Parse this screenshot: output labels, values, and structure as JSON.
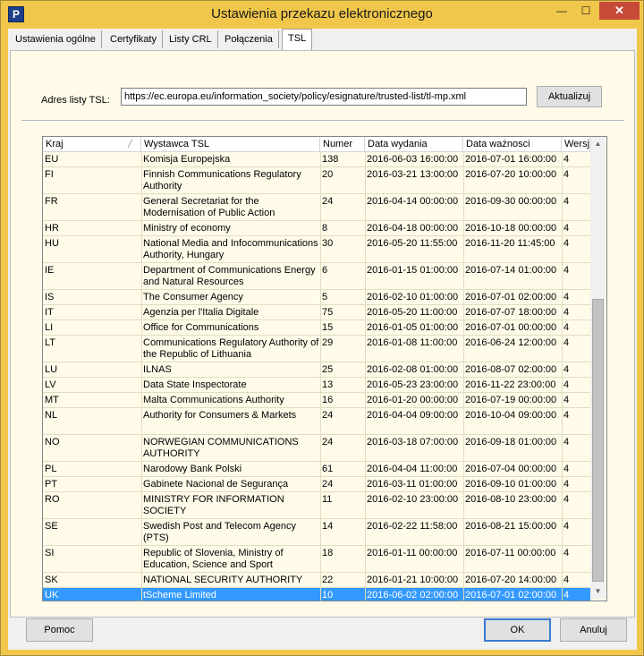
{
  "window": {
    "title": "Ustawienia przekazu elektronicznego",
    "app_icon": "P",
    "minimize": "—",
    "maximize": "☐",
    "close": "✕"
  },
  "tabs": [
    "Ustawienia ogólne",
    "Certyfikaty",
    "Listy CRL",
    "Połączenia",
    "TSL"
  ],
  "active_tab": "TSL",
  "tsl": {
    "address_label": "Adres listy TSL:",
    "address_value": "https://ec.europa.eu/information_society/policy/esignature/trusted-list/tl-mp.xml",
    "update_button": "Aktualizuj"
  },
  "table": {
    "columns": [
      "Kraj",
      "Wystawca TSL",
      "Numer",
      "Data wydania",
      "Data ważnosci",
      "Wersja"
    ],
    "rows": [
      [
        "EU",
        "Komisja Europejska",
        "138",
        "2016-06-03 16:00:00",
        "2016-07-01 16:00:00",
        "4"
      ],
      [
        "FI",
        "Finnish Communications Regulatory Authority",
        "20",
        "2016-03-21 13:00:00",
        "2016-07-20 10:00:00",
        "4"
      ],
      [
        "FR",
        "General Secretariat for the Modernisation of Public Action",
        "24",
        "2016-04-14 00:00:00",
        "2016-09-30 00:00:00",
        "4"
      ],
      [
        "HR",
        "Ministry of economy",
        "8",
        "2016-04-18 00:00:00",
        "2016-10-18 00:00:00",
        "4"
      ],
      [
        "HU",
        "National Media and Infocommunications Authority, Hungary",
        "30",
        "2016-05-20 11:55:00",
        "2016-11-20 11:45:00",
        "4"
      ],
      [
        "IE",
        "Department of Communications Energy and Natural Resources",
        "6",
        "2016-01-15 01:00:00",
        "2016-07-14 01:00:00",
        "4"
      ],
      [
        "IS",
        "The Consumer Agency",
        "5",
        "2016-02-10 01:00:00",
        "2016-07-01 02:00:00",
        "4"
      ],
      [
        "IT",
        "Agenzia per l'Italia Digitale",
        "75",
        "2016-05-20 11:00:00",
        "2016-07-07 18:00:00",
        "4"
      ],
      [
        "LI",
        "Office for Communications",
        "15",
        "2016-01-05 01:00:00",
        "2016-07-01 00:00:00",
        "4"
      ],
      [
        "LT",
        "Communications Regulatory Authority of the Republic of Lithuania",
        "29",
        "2016-01-08 11:00:00",
        "2016-06-24 12:00:00",
        "4"
      ],
      [
        "LU",
        "ILNAS",
        "25",
        "2016-02-08 01:00:00",
        "2016-08-07 02:00:00",
        "4"
      ],
      [
        "LV",
        "Data State Inspectorate",
        "13",
        "2016-05-23 23:00:00",
        "2016-11-22 23:00:00",
        "4"
      ],
      [
        "MT",
        "Malta Communications Authority",
        "16",
        "2016-01-20 00:00:00",
        "2016-07-19 00:00:00",
        "4"
      ],
      [
        "NL",
        "Authority for Consumers & Markets",
        "24",
        "2016-04-04 09:00:00",
        "2016-10-04 09:00:00",
        "4"
      ],
      [
        "NO",
        "NORWEGIAN COMMUNICATIONS AUTHORITY",
        "24",
        "2016-03-18 07:00:00",
        "2016-09-18 01:00:00",
        "4"
      ],
      [
        "PL",
        "Narodowy Bank Polski",
        "61",
        "2016-04-04 11:00:00",
        "2016-07-04 00:00:00",
        "4"
      ],
      [
        "PT",
        "Gabinete Nacional de Segurança",
        "24",
        "2016-03-11 01:00:00",
        "2016-09-10 01:00:00",
        "4"
      ],
      [
        "RO",
        "MINISTRY FOR INFORMATION SOCIETY",
        "11",
        "2016-02-10 23:00:00",
        "2016-08-10 23:00:00",
        "4"
      ],
      [
        "SE",
        "Swedish Post and Telecom Agency (PTS)",
        "14",
        "2016-02-22 11:58:00",
        "2016-08-21 15:00:00",
        "4"
      ],
      [
        "SI",
        "Republic of Slovenia, Ministry of Education, Science and Sport",
        "18",
        "2016-01-11 00:00:00",
        "2016-07-11 00:00:00",
        "4"
      ],
      [
        "SK",
        "NATIONAL SECURITY AUTHORITY",
        "22",
        "2016-01-21 10:00:00",
        "2016-07-20 14:00:00",
        "4"
      ],
      [
        "UK",
        "tScheme Limited",
        "10",
        "2016-06-02 02:00:00",
        "2016-07-01 02:00:00",
        "4"
      ]
    ],
    "selected_index": 21
  },
  "buttons": {
    "help": "Pomoc",
    "ok": "OK",
    "cancel": "Anuluj"
  },
  "icons": {
    "sort": "sort-ascending-icon",
    "scroll_up": "scroll-up-arrow-icon",
    "scroll_down": "scroll-down-arrow-icon"
  },
  "colors": {
    "title_bar": "#f0c74a",
    "selection": "#3399ff",
    "close_button": "#c74a38",
    "panel_bg": "#fffbe8"
  }
}
